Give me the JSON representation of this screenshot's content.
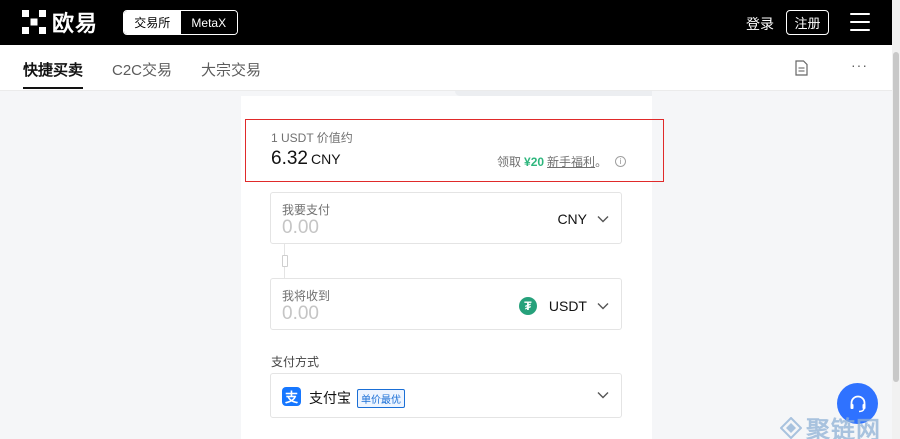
{
  "header": {
    "brand": "欧易",
    "switch_exchange": "交易所",
    "switch_metax": "MetaX",
    "login": "登录",
    "register": "注册"
  },
  "subnav": {
    "tabs": [
      {
        "label": "快捷买卖",
        "active": true
      },
      {
        "label": "C2C交易",
        "active": false
      },
      {
        "label": "大宗交易",
        "active": false
      }
    ],
    "more": "···"
  },
  "price": {
    "label": "1 USDT 价值约",
    "value": "6.32",
    "unit": "CNY",
    "bonus_prefix": "领取",
    "bonus_amount": "¥20",
    "bonus_link": "新手福利",
    "bonus_suffix": "。",
    "info": "i"
  },
  "pay_field": {
    "label": "我要支付",
    "placeholder": "0.00",
    "currency": "CNY"
  },
  "receive_field": {
    "label": "我将收到",
    "placeholder": "0.00",
    "currency": "USDT",
    "currency_icon": "₮"
  },
  "payment": {
    "title": "支付方式",
    "method_icon": "支",
    "method": "支付宝",
    "badge": "单价最优"
  },
  "watermark": "聚链网",
  "colors": {
    "accent_green": "#2eb67d",
    "highlight_red": "#e02a2a",
    "support_blue": "#2f72ff",
    "alipay_blue": "#1677ff",
    "tether_green": "#26a17b"
  }
}
